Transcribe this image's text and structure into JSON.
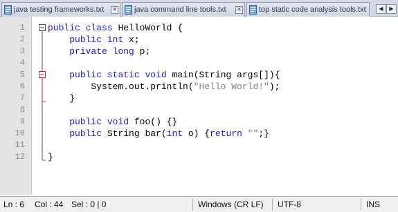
{
  "tabs": [
    {
      "label": "java testing frameworks.txt",
      "active": false
    },
    {
      "label": "java command line tools.txt",
      "active": false
    },
    {
      "label": "top static code analysis tools.txt",
      "active": false
    }
  ],
  "tab_close_glyph": "×",
  "tab_scroll": {
    "left": "◀",
    "right": "▶"
  },
  "editor": {
    "lines": [
      {
        "number": "1",
        "tokens": [
          {
            "t": "public",
            "c": "kw"
          },
          {
            "t": " "
          },
          {
            "t": "class",
            "c": "kw"
          },
          {
            "t": " HelloWorld {"
          }
        ]
      },
      {
        "number": "2",
        "tokens": [
          {
            "t": "    "
          },
          {
            "t": "public",
            "c": "kw"
          },
          {
            "t": " "
          },
          {
            "t": "int",
            "c": "kw"
          },
          {
            "t": " x;"
          }
        ]
      },
      {
        "number": "3",
        "tokens": [
          {
            "t": "    "
          },
          {
            "t": "private",
            "c": "kw"
          },
          {
            "t": " "
          },
          {
            "t": "long",
            "c": "kw"
          },
          {
            "t": " p;"
          }
        ]
      },
      {
        "number": "4",
        "tokens": []
      },
      {
        "number": "5",
        "tokens": [
          {
            "t": "    "
          },
          {
            "t": "public",
            "c": "kw"
          },
          {
            "t": " "
          },
          {
            "t": "static",
            "c": "kw"
          },
          {
            "t": " "
          },
          {
            "t": "void",
            "c": "kw"
          },
          {
            "t": " main(String args[]){"
          }
        ]
      },
      {
        "number": "6",
        "tokens": [
          {
            "t": "        System.out.println("
          },
          {
            "t": "\"Hello World!\"",
            "c": "str"
          },
          {
            "t": ");"
          }
        ]
      },
      {
        "number": "7",
        "tokens": [
          {
            "t": "    }"
          }
        ]
      },
      {
        "number": "8",
        "tokens": []
      },
      {
        "number": "9",
        "tokens": [
          {
            "t": "    "
          },
          {
            "t": "public",
            "c": "kw"
          },
          {
            "t": " "
          },
          {
            "t": "void",
            "c": "kw"
          },
          {
            "t": " foo() {}"
          }
        ]
      },
      {
        "number": "10",
        "tokens": [
          {
            "t": "    "
          },
          {
            "t": "public",
            "c": "kw"
          },
          {
            "t": " String bar("
          },
          {
            "t": "int",
            "c": "kw"
          },
          {
            "t": " o) {"
          },
          {
            "t": "return",
            "c": "kw"
          },
          {
            "t": " "
          },
          {
            "t": "\"\"",
            "c": "str"
          },
          {
            "t": ";}"
          }
        ]
      },
      {
        "number": "11",
        "tokens": []
      },
      {
        "number": "12",
        "tokens": [
          {
            "t": "}"
          }
        ]
      }
    ]
  },
  "statusbar": {
    "ln": "Ln : 6",
    "col": "Col : 44",
    "sel": "Sel : 0 | 0",
    "eol": "Windows (CR LF)",
    "encoding": "UTF-8",
    "mode": "INS"
  },
  "colors": {
    "keyword": "#1a1adc",
    "string": "#808080",
    "fold_marker_red": "#cc2222",
    "gutter_bg": "#e4e4e4"
  }
}
